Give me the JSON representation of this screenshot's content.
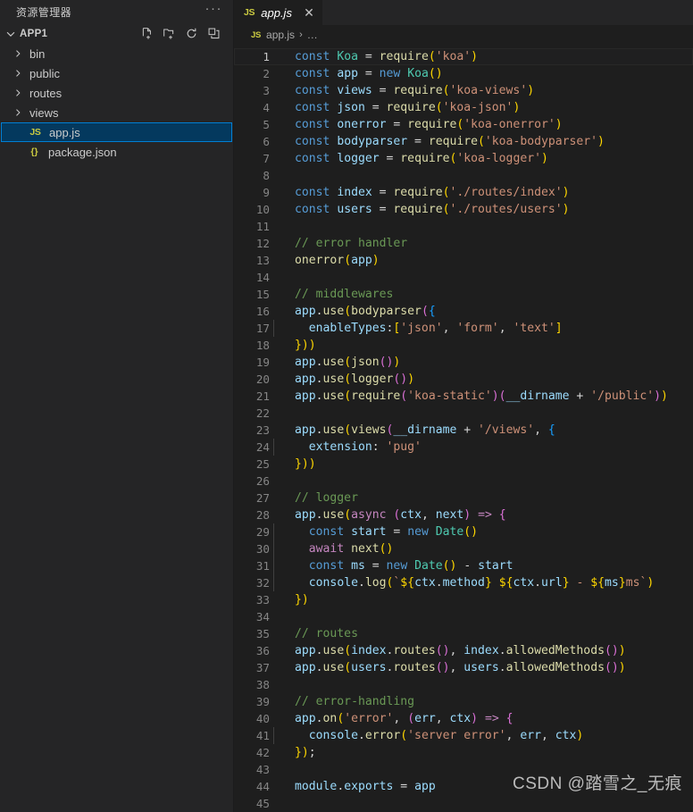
{
  "sidebar": {
    "title": "资源管理器",
    "more_label": "···",
    "section": {
      "label": "APP1",
      "expanded": true,
      "actions": [
        {
          "name": "new-file-icon",
          "tooltip": "新建文件"
        },
        {
          "name": "new-folder-icon",
          "tooltip": "新建文件夹"
        },
        {
          "name": "refresh-icon",
          "tooltip": "刷新资源管理器"
        },
        {
          "name": "collapse-all-icon",
          "tooltip": "在资源管理器中折叠文件夹"
        }
      ]
    },
    "tree": [
      {
        "label": "bin",
        "type": "folder",
        "expanded": false,
        "selected": false,
        "icon": "chevron-right-icon"
      },
      {
        "label": "public",
        "type": "folder",
        "expanded": false,
        "selected": false,
        "icon": "chevron-right-icon"
      },
      {
        "label": "routes",
        "type": "folder",
        "expanded": false,
        "selected": false,
        "icon": "chevron-right-icon"
      },
      {
        "label": "views",
        "type": "folder",
        "expanded": false,
        "selected": false,
        "icon": "chevron-right-icon"
      },
      {
        "label": "app.js",
        "type": "file",
        "selected": true,
        "icon": "js-file-icon",
        "icon_text": "JS"
      },
      {
        "label": "package.json",
        "type": "file",
        "selected": false,
        "icon": "json-file-icon",
        "icon_text": "{}"
      }
    ]
  },
  "editor": {
    "tab": {
      "icon_text": "JS",
      "label": "app.js",
      "close_label": "✕",
      "preview_italic": true,
      "active": true
    },
    "breadcrumb": {
      "icon_text": "JS",
      "file": "app.js",
      "separator": "›",
      "symbol": "…"
    },
    "current_line": 1,
    "total_lines": 45,
    "watermark": "CSDN @踏雪之_无痕",
    "code": [
      {
        "n": 1,
        "text": "const Koa = require('koa')"
      },
      {
        "n": 2,
        "text": "const app = new Koa()"
      },
      {
        "n": 3,
        "text": "const views = require('koa-views')"
      },
      {
        "n": 4,
        "text": "const json = require('koa-json')"
      },
      {
        "n": 5,
        "text": "const onerror = require('koa-onerror')"
      },
      {
        "n": 6,
        "text": "const bodyparser = require('koa-bodyparser')"
      },
      {
        "n": 7,
        "text": "const logger = require('koa-logger')"
      },
      {
        "n": 8,
        "text": ""
      },
      {
        "n": 9,
        "text": "const index = require('./routes/index')"
      },
      {
        "n": 10,
        "text": "const users = require('./routes/users')"
      },
      {
        "n": 11,
        "text": ""
      },
      {
        "n": 12,
        "text": "// error handler"
      },
      {
        "n": 13,
        "text": "onerror(app)"
      },
      {
        "n": 14,
        "text": ""
      },
      {
        "n": 15,
        "text": "// middlewares"
      },
      {
        "n": 16,
        "text": "app.use(bodyparser({"
      },
      {
        "n": 17,
        "text": "  enableTypes:['json', 'form', 'text']"
      },
      {
        "n": 18,
        "text": "}))"
      },
      {
        "n": 19,
        "text": "app.use(json())"
      },
      {
        "n": 20,
        "text": "app.use(logger())"
      },
      {
        "n": 21,
        "text": "app.use(require('koa-static')(__dirname + '/public'))"
      },
      {
        "n": 22,
        "text": ""
      },
      {
        "n": 23,
        "text": "app.use(views(__dirname + '/views', {"
      },
      {
        "n": 24,
        "text": "  extension: 'pug'"
      },
      {
        "n": 25,
        "text": "}))"
      },
      {
        "n": 26,
        "text": ""
      },
      {
        "n": 27,
        "text": "// logger"
      },
      {
        "n": 28,
        "text": "app.use(async (ctx, next) => {"
      },
      {
        "n": 29,
        "text": "  const start = new Date()"
      },
      {
        "n": 30,
        "text": "  await next()"
      },
      {
        "n": 31,
        "text": "  const ms = new Date() - start"
      },
      {
        "n": 32,
        "text": "  console.log(`${ctx.method} ${ctx.url} - ${ms}ms`)"
      },
      {
        "n": 33,
        "text": "})"
      },
      {
        "n": 34,
        "text": ""
      },
      {
        "n": 35,
        "text": "// routes"
      },
      {
        "n": 36,
        "text": "app.use(index.routes(), index.allowedMethods())"
      },
      {
        "n": 37,
        "text": "app.use(users.routes(), users.allowedMethods())"
      },
      {
        "n": 38,
        "text": ""
      },
      {
        "n": 39,
        "text": "// error-handling"
      },
      {
        "n": 40,
        "text": "app.on('error', (err, ctx) => {"
      },
      {
        "n": 41,
        "text": "  console.error('server error', err, ctx)"
      },
      {
        "n": 42,
        "text": "});"
      },
      {
        "n": 43,
        "text": ""
      },
      {
        "n": 44,
        "text": "module.exports = app"
      },
      {
        "n": 45,
        "text": ""
      }
    ]
  },
  "colors": {
    "editor_bg": "#1e1e1e",
    "sidebar_bg": "#252526",
    "selection_bg": "#04395e",
    "selection_border": "#007fd4",
    "keyword": "#569cd6",
    "control": "#c586c0",
    "variable": "#9cdcfe",
    "function": "#dcdcaa",
    "string": "#ce9178",
    "comment": "#6a9955",
    "type": "#4ec9b0",
    "bracket1": "#ffd700",
    "bracket2": "#da70d6",
    "bracket3": "#179fff"
  }
}
